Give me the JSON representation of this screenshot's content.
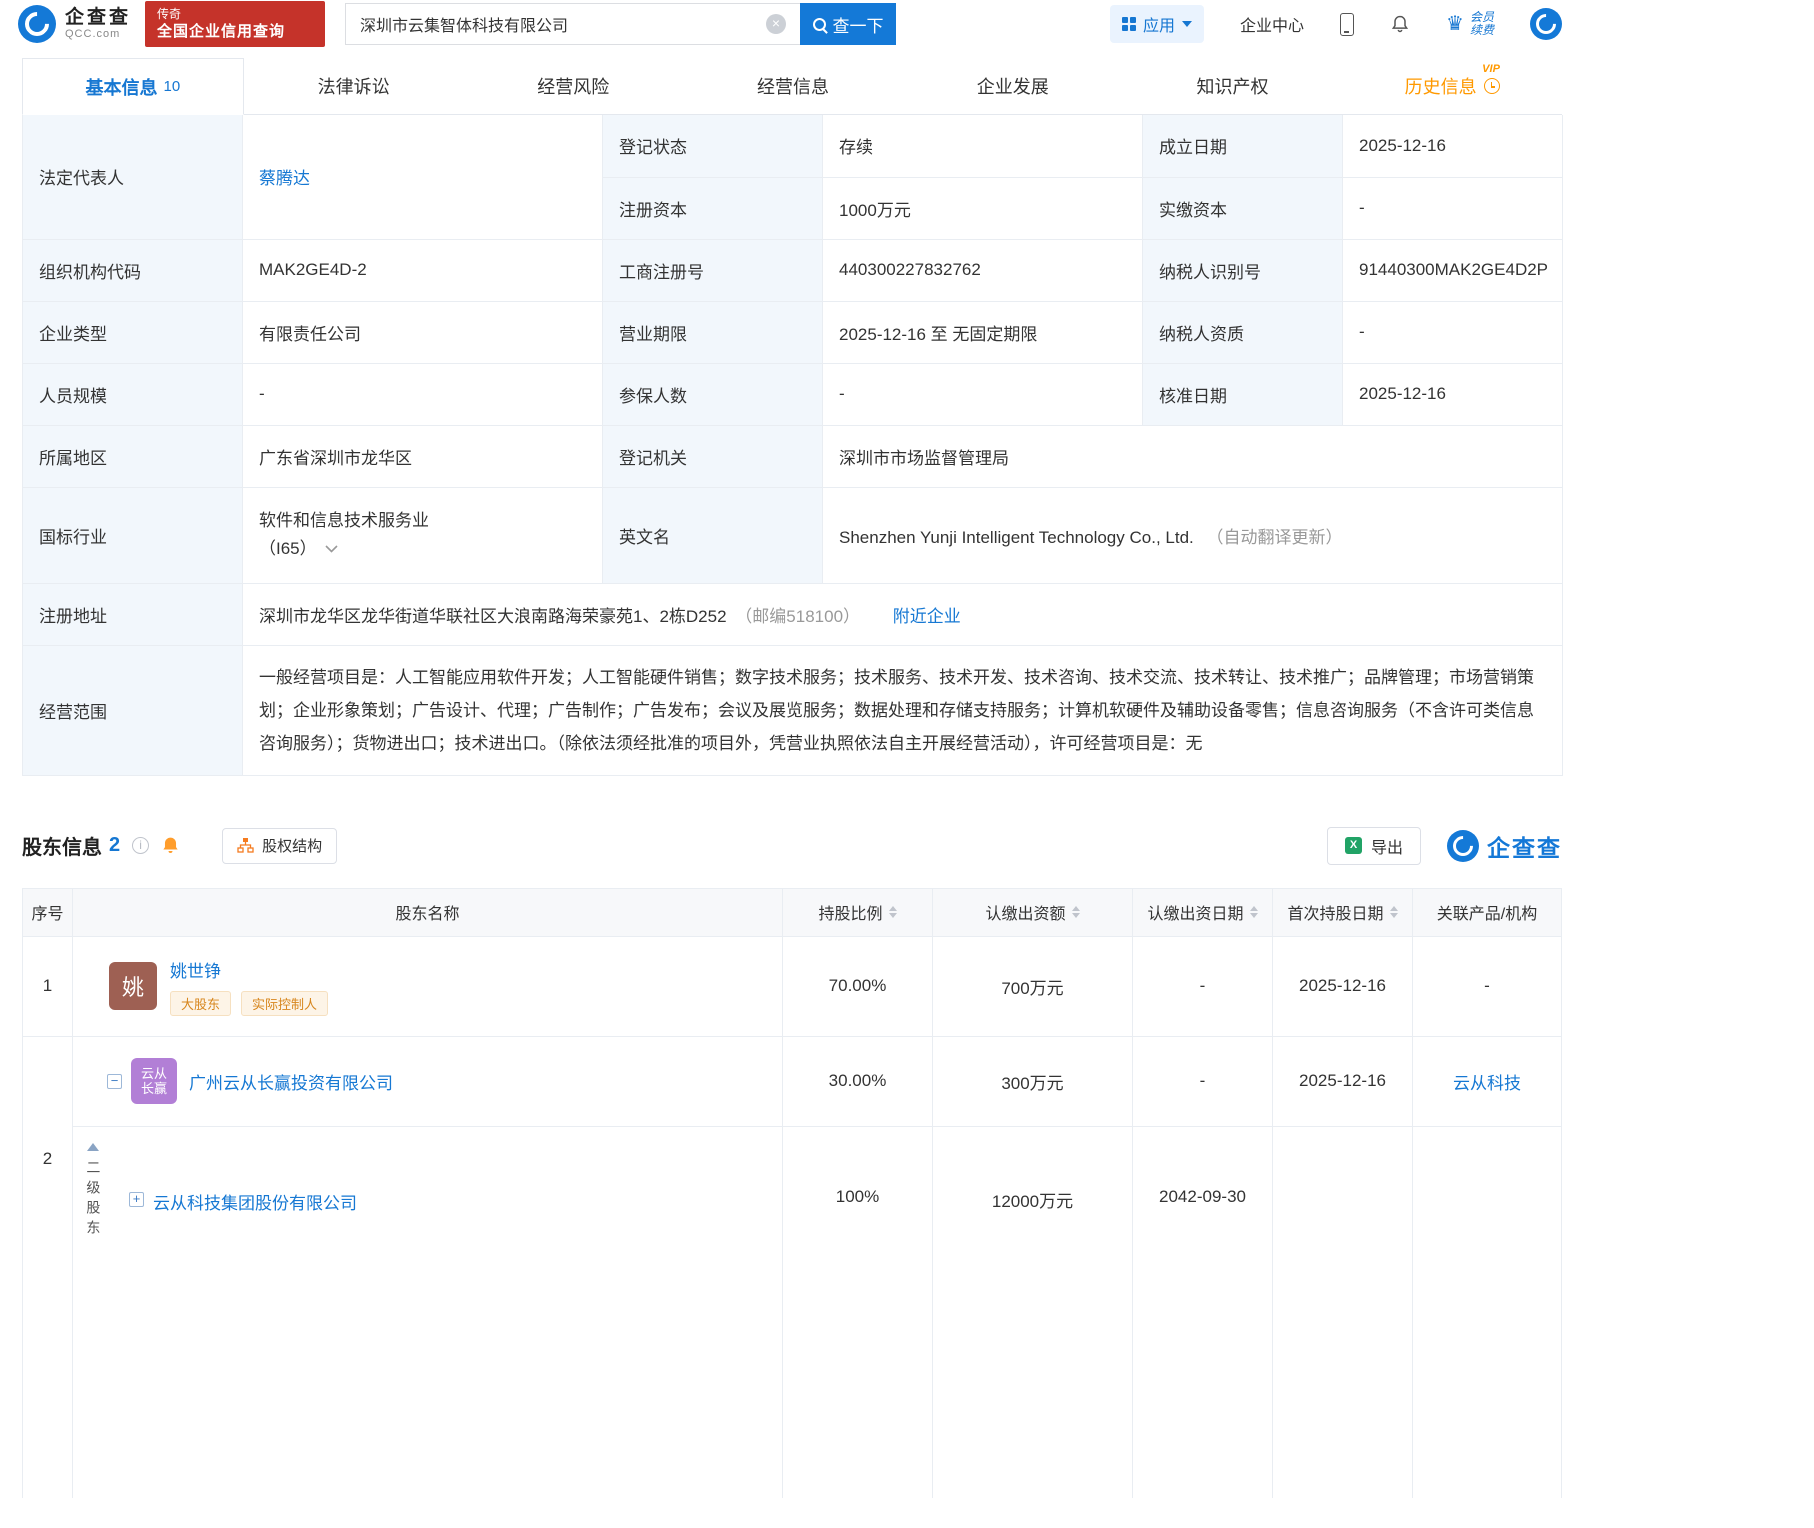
{
  "colors": {
    "brand_blue": "#1479d7",
    "link_blue": "#1678d3",
    "tab_active_blue": "#1677d2",
    "history_orange": "#ff9900",
    "promo_red": "#c5332a",
    "label_cell_bg": "#f2f7fc",
    "tag_orange": "#d7861d",
    "avatar_brown": "#9e6053",
    "avatar_purple": "#b27fd6",
    "excel_green": "#21a366"
  },
  "header": {
    "logo_cn": "企查查",
    "logo_en": "QCC.com",
    "promo_line1": "传奇",
    "promo_line2": "全国企业信用查询",
    "search_value": "深圳市云集智体科技有限公司",
    "search_button": "查一下",
    "nav_apps": "应用",
    "nav_center": "企业中心",
    "vip_line1": "会员",
    "vip_line2": "续费"
  },
  "tabs": [
    {
      "label": "基本信息",
      "count": "10"
    },
    {
      "label": "法律诉讼"
    },
    {
      "label": "经营风险"
    },
    {
      "label": "经营信息"
    },
    {
      "label": "企业发展"
    },
    {
      "label": "知识产权"
    },
    {
      "label": "历史信息",
      "vip": "VIP"
    }
  ],
  "basic": {
    "legal_rep": {
      "label": "法定代表人",
      "value": "蔡腾达"
    },
    "reg_status": {
      "label": "登记状态",
      "value": "存续"
    },
    "establish_date": {
      "label": "成立日期",
      "value": "2025-12-16"
    },
    "reg_capital": {
      "label": "注册资本",
      "value": "1000万元"
    },
    "paid_capital": {
      "label": "实缴资本",
      "value": "-"
    },
    "org_code": {
      "label": "组织机构代码",
      "value": "MAK2GE4D-2"
    },
    "biz_reg_no": {
      "label": "工商注册号",
      "value": "440300227832762"
    },
    "taxpayer_id": {
      "label": "纳税人识别号",
      "value": "91440300MAK2GE4D2P"
    },
    "company_type": {
      "label": "企业类型",
      "value": "有限责任公司"
    },
    "biz_term": {
      "label": "营业期限",
      "value": "2025-12-16 至 无固定期限"
    },
    "taxpayer_quality": {
      "label": "纳税人资质",
      "value": "-"
    },
    "staff_size": {
      "label": "人员规模",
      "value": "-"
    },
    "insured_count": {
      "label": "参保人数",
      "value": "-"
    },
    "approval_date": {
      "label": "核准日期",
      "value": "2025-12-16"
    },
    "region": {
      "label": "所属地区",
      "value": "广东省深圳市龙华区"
    },
    "reg_authority": {
      "label": "登记机关",
      "value": "深圳市市场监督管理局"
    },
    "industry": {
      "label": "国标行业",
      "line1": "软件和信息技术服务业",
      "line2": "（I65）"
    },
    "english_name": {
      "label": "英文名",
      "value": "Shenzhen Yunji Intelligent Technology Co., Ltd.",
      "note": "（自动翻译更新）"
    },
    "address": {
      "label": "注册地址",
      "value": "深圳市龙华区龙华街道华联社区大浪南路海荣豪苑1、2栋D252",
      "postcode": "（邮编518100）",
      "nearby": "附近企业"
    },
    "scope": {
      "label": "经营范围",
      "value": "一般经营项目是：人工智能应用软件开发；人工智能硬件销售；数字技术服务；技术服务、技术开发、技术咨询、技术交流、技术转让、技术推广；品牌管理；市场营销策划；企业形象策划；广告设计、代理；广告制作；广告发布；会议及展览服务；数据处理和存储支持服务；计算机软硬件及辅助设备零售；信息咨询服务（不含许可类信息咨询服务）；货物进出口；技术进出口。（除依法须经批准的项目外，凭营业执照依法自主开展经营活动），许可经营项目是：无"
    }
  },
  "shareholders": {
    "title": "股东信息",
    "count": "2",
    "equity_button": "股权结构",
    "export_button": "导出",
    "brand": "企查查",
    "columns": {
      "no": "序号",
      "name": "股东名称",
      "ratio": "持股比例",
      "amount": "认缴出资额",
      "sub_date": "认缴出资日期",
      "first_date": "首次持股日期",
      "related": "关联产品/机构"
    },
    "row1": {
      "no": "1",
      "avatar": "姚",
      "name": "姚世铮",
      "tag1": "大股东",
      "tag2": "实际控制人",
      "ratio": "70.00%",
      "amount": "700万元",
      "sub_date": "-",
      "first_date": "2025-12-16",
      "related": "-"
    },
    "row2": {
      "no": "2",
      "avatar_l1": "云从",
      "avatar_l2": "长赢",
      "name": "广州云从长赢投资有限公司",
      "ratio": "30.00%",
      "amount": "300万元",
      "sub_date": "-",
      "first_date": "2025-12-16",
      "related": "云从科技",
      "group_label": "二级股东",
      "child": {
        "name": "云从科技集团股份有限公司",
        "ratio": "100%",
        "amount": "12000万元",
        "sub_date": "2042-09-30"
      }
    }
  }
}
